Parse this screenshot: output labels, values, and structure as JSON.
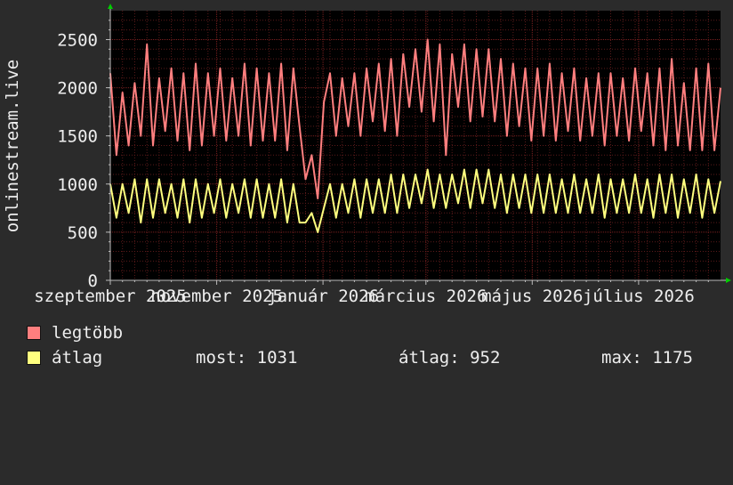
{
  "chart_data": {
    "type": "line",
    "ylabel": "onlinestream.live",
    "ylim": [
      0,
      2800
    ],
    "y_ticks": [
      "0",
      "500",
      "1000",
      "1500",
      "2000",
      "2500"
    ],
    "y_tick_values": [
      0,
      500,
      1000,
      1500,
      2000,
      2500
    ],
    "xlim": [
      0,
      350
    ],
    "x_tick_labels": [
      "szeptember 2025",
      "november 2025",
      "január 2026",
      "március 2026",
      "május 2026",
      "július 2026"
    ],
    "x_tick_days": [
      0,
      61,
      122,
      181,
      242,
      303
    ],
    "grid": true,
    "legend_placement": "bottom",
    "colors": {
      "background": "#2b2b2b",
      "plot": "#000000",
      "grid": "#5a1a1a",
      "axis": "#bbbbbb",
      "arrow": "#00cc00"
    },
    "series": [
      {
        "name": "legtöbb",
        "color": "#ff7f7f",
        "x": [
          0,
          3.5,
          7,
          10.5,
          14,
          17.5,
          21,
          24.5,
          28,
          31.5,
          35,
          38.5,
          42,
          45.5,
          49,
          52.5,
          56,
          59.5,
          63,
          66.5,
          70,
          73.5,
          77,
          80.5,
          84,
          87.5,
          91,
          94.5,
          98,
          101.5,
          105,
          108.5,
          112,
          115.5,
          119,
          122.5,
          126,
          129.5,
          133,
          136.5,
          140,
          143.5,
          147,
          150.5,
          154,
          157.5,
          161,
          164.5,
          168,
          171.5,
          175,
          178.5,
          182,
          185.5,
          189,
          192.5,
          196,
          199.5,
          203,
          206.5,
          210,
          213.5,
          217,
          220.5,
          224,
          227.5,
          231,
          234.5,
          238,
          241.5,
          245,
          248.5,
          252,
          255.5,
          259,
          262.5,
          266,
          269.5,
          273,
          276.5,
          280,
          283.5,
          287,
          290.5,
          294,
          297.5,
          301,
          304.5,
          308,
          311.5,
          315,
          318.5,
          322,
          325.5,
          329,
          332.5,
          336,
          339.5,
          343,
          346.5,
          350
        ],
        "values": [
          2150,
          1300,
          1950,
          1400,
          2050,
          1500,
          2450,
          1400,
          2100,
          1550,
          2200,
          1450,
          2150,
          1350,
          2250,
          1400,
          2150,
          1500,
          2200,
          1450,
          2100,
          1500,
          2250,
          1400,
          2200,
          1450,
          2150,
          1450,
          2250,
          1350,
          2200,
          1600,
          1050,
          1300,
          850,
          1850,
          2150,
          1500,
          2100,
          1600,
          2150,
          1500,
          2200,
          1650,
          2250,
          1550,
          2300,
          1500,
          2350,
          1800,
          2400,
          1750,
          2500,
          1650,
          2450,
          1300,
          2350,
          1800,
          2450,
          1650,
          2400,
          1700,
          2400,
          1650,
          2300,
          1500,
          2250,
          1600,
          2200,
          1450,
          2200,
          1500,
          2250,
          1450,
          2150,
          1550,
          2200,
          1450,
          2100,
          1500,
          2150,
          1400,
          2150,
          1500,
          2100,
          1450,
          2200,
          1550,
          2150,
          1400,
          2200,
          1350,
          2300,
          1400,
          2050,
          1350,
          2200,
          1350,
          2250,
          1350,
          2000
        ]
      },
      {
        "name": "átlag",
        "color": "#ffff7f",
        "x": [
          0,
          3.5,
          7,
          10.5,
          14,
          17.5,
          21,
          24.5,
          28,
          31.5,
          35,
          38.5,
          42,
          45.5,
          49,
          52.5,
          56,
          59.5,
          63,
          66.5,
          70,
          73.5,
          77,
          80.5,
          84,
          87.5,
          91,
          94.5,
          98,
          101.5,
          105,
          108.5,
          112,
          115.5,
          119,
          122.5,
          126,
          129.5,
          133,
          136.5,
          140,
          143.5,
          147,
          150.5,
          154,
          157.5,
          161,
          164.5,
          168,
          171.5,
          175,
          178.5,
          182,
          185.5,
          189,
          192.5,
          196,
          199.5,
          203,
          206.5,
          210,
          213.5,
          217,
          220.5,
          224,
          227.5,
          231,
          234.5,
          238,
          241.5,
          245,
          248.5,
          252,
          255.5,
          259,
          262.5,
          266,
          269.5,
          273,
          276.5,
          280,
          283.5,
          287,
          290.5,
          294,
          297.5,
          301,
          304.5,
          308,
          311.5,
          315,
          318.5,
          322,
          325.5,
          329,
          332.5,
          336,
          339.5,
          343,
          346.5,
          350
        ],
        "values": [
          1000,
          650,
          1000,
          700,
          1050,
          600,
          1050,
          650,
          1050,
          700,
          1000,
          650,
          1050,
          600,
          1050,
          650,
          1000,
          700,
          1050,
          650,
          1000,
          700,
          1050,
          650,
          1050,
          650,
          1000,
          650,
          1050,
          600,
          1000,
          600,
          600,
          700,
          500,
          750,
          1000,
          650,
          1000,
          700,
          1050,
          650,
          1050,
          700,
          1050,
          700,
          1100,
          700,
          1100,
          750,
          1100,
          800,
          1150,
          750,
          1100,
          750,
          1100,
          800,
          1150,
          750,
          1150,
          800,
          1150,
          750,
          1100,
          700,
          1100,
          750,
          1100,
          700,
          1100,
          700,
          1100,
          700,
          1050,
          700,
          1100,
          700,
          1050,
          700,
          1100,
          650,
          1050,
          700,
          1050,
          700,
          1100,
          700,
          1050,
          650,
          1100,
          700,
          1100,
          650,
          1050,
          700,
          1100,
          650,
          1050,
          700,
          1030
        ]
      }
    ]
  },
  "legend": [
    {
      "label": "legtöbb",
      "color": "#ff7f7f"
    },
    {
      "label": "átlag",
      "color": "#ffff7f"
    }
  ],
  "stats": {
    "current": "most: 1031",
    "average": "átlag: 952",
    "max": "max: 1175"
  }
}
